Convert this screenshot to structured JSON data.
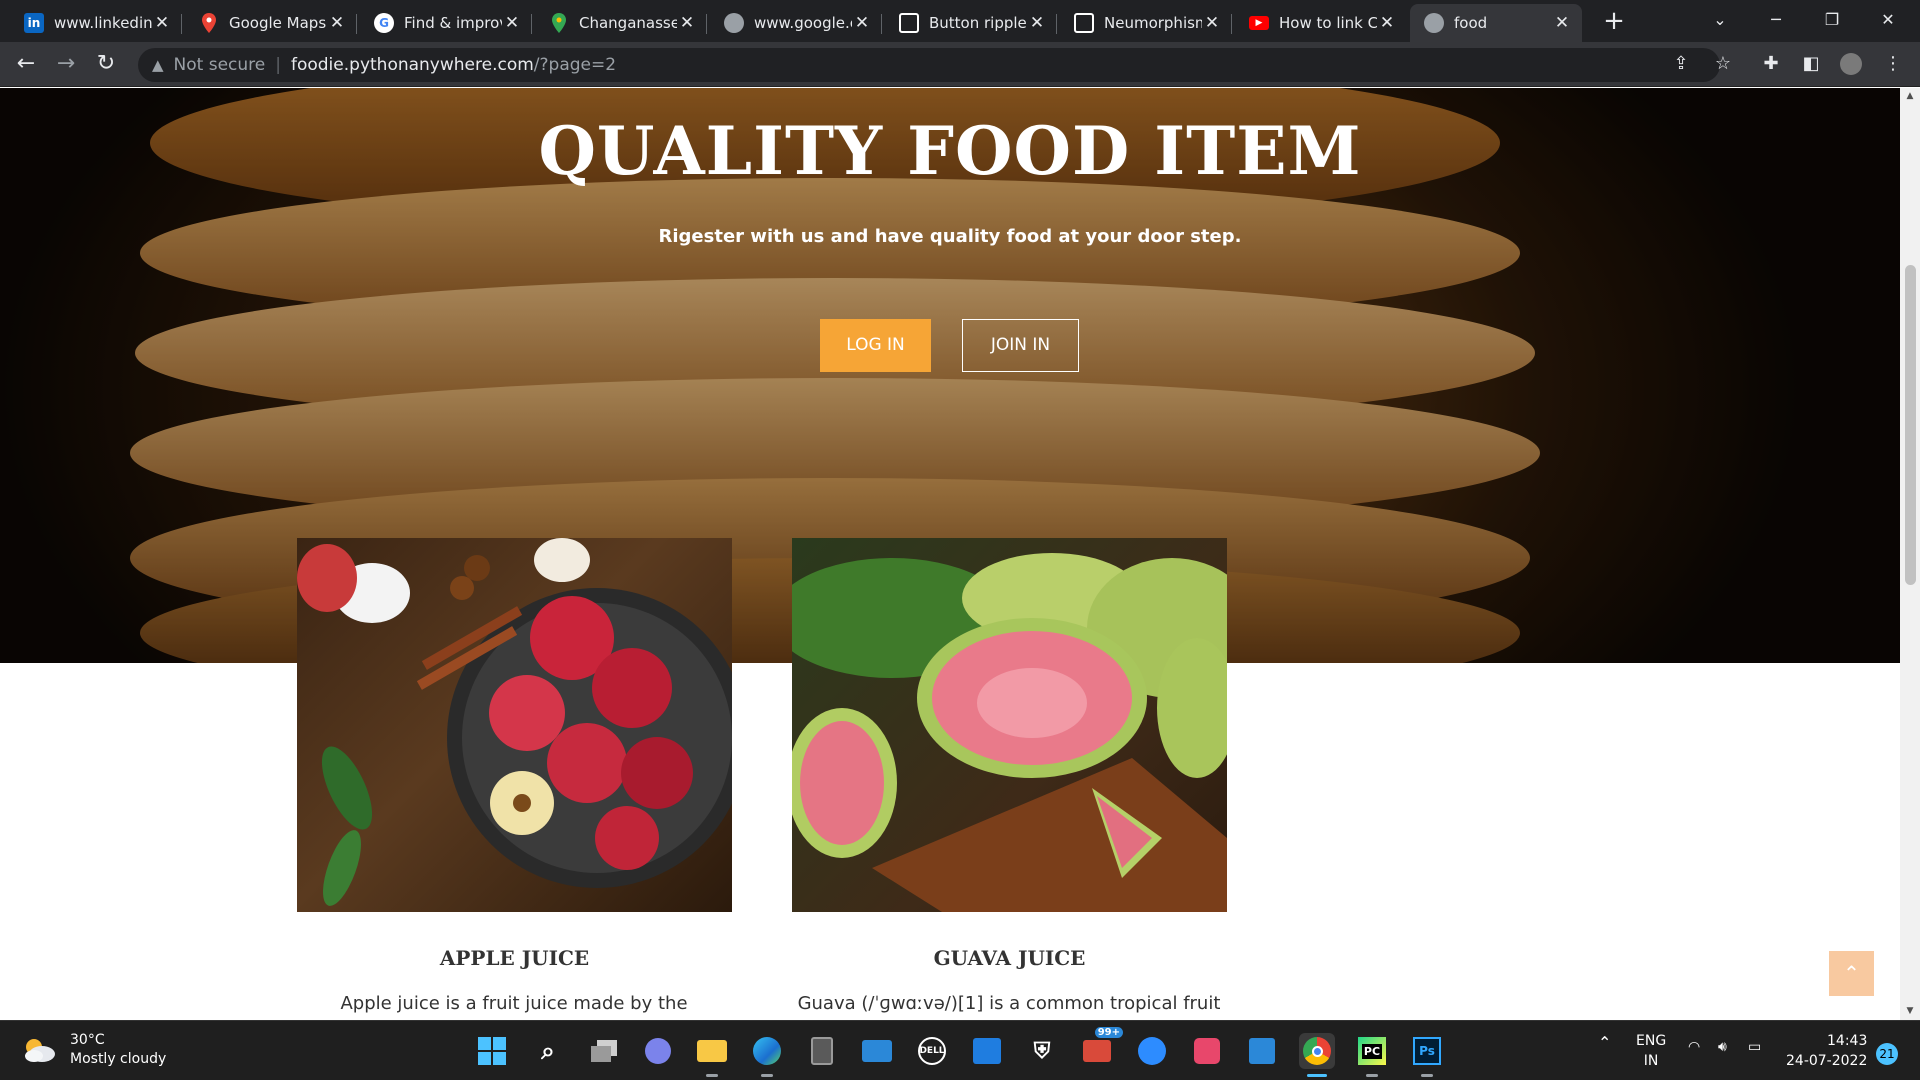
{
  "browser": {
    "tabs": [
      {
        "title": "www.linkedin.c",
        "icon": "linkedin-icon",
        "color": "#0a66c2",
        "glyph": "in"
      },
      {
        "title": "Google Maps",
        "icon": "maps-pin-icon",
        "color": "#ea4335",
        "glyph": ""
      },
      {
        "title": "Find & improv",
        "icon": "google-g-icon",
        "color": "#ffffff",
        "glyph": "G"
      },
      {
        "title": "Changanasser",
        "icon": "maps-pin-icon",
        "color": "#ea4335",
        "glyph": ""
      },
      {
        "title": "www.google.c",
        "icon": "globe-icon",
        "color": "#9aa0a6",
        "glyph": ""
      },
      {
        "title": "Button ripple",
        "icon": "codepen-icon",
        "color": "#ffffff",
        "glyph": ""
      },
      {
        "title": "Neumorphism",
        "icon": "codepen-icon",
        "color": "#ffffff",
        "glyph": ""
      },
      {
        "title": "How to link C",
        "icon": "youtube-icon",
        "color": "#ff0000",
        "glyph": "▶"
      },
      {
        "title": "food",
        "icon": "globe-icon",
        "color": "#9aa0a6",
        "glyph": ""
      }
    ],
    "close_glyph": "✕",
    "new_tab_glyph": "+",
    "address": {
      "security_label": "Not secure",
      "host": "foodie.pythonanywhere.com",
      "path": "/?page=2"
    }
  },
  "hero": {
    "title": "QUALITY FOOD ITEM",
    "subtitle": "Rigester with us and have quality food at your door step.",
    "login_label": "LOG IN",
    "join_label": "JOIN IN"
  },
  "products": [
    {
      "title": "APPLE JUICE",
      "text": "Apple juice is a fruit juice made by the"
    },
    {
      "title": "GUAVA JUICE",
      "text": "Guava (/ˈɡwɑːvə/)[1] is a common tropical fruit"
    }
  ],
  "back_to_top_glyph": "⌃",
  "taskbar": {
    "weather_temp": "30°C",
    "weather_desc": "Mostly cloudy",
    "mail_badge": "99+",
    "lang_top": "ENG",
    "lang_bottom": "IN",
    "time": "14:43",
    "date": "24-07-2022",
    "notification_count": "21"
  },
  "colors": {
    "accent_orange": "#f6a536",
    "browser_dark": "#202124",
    "browser_bar": "#35363a"
  }
}
